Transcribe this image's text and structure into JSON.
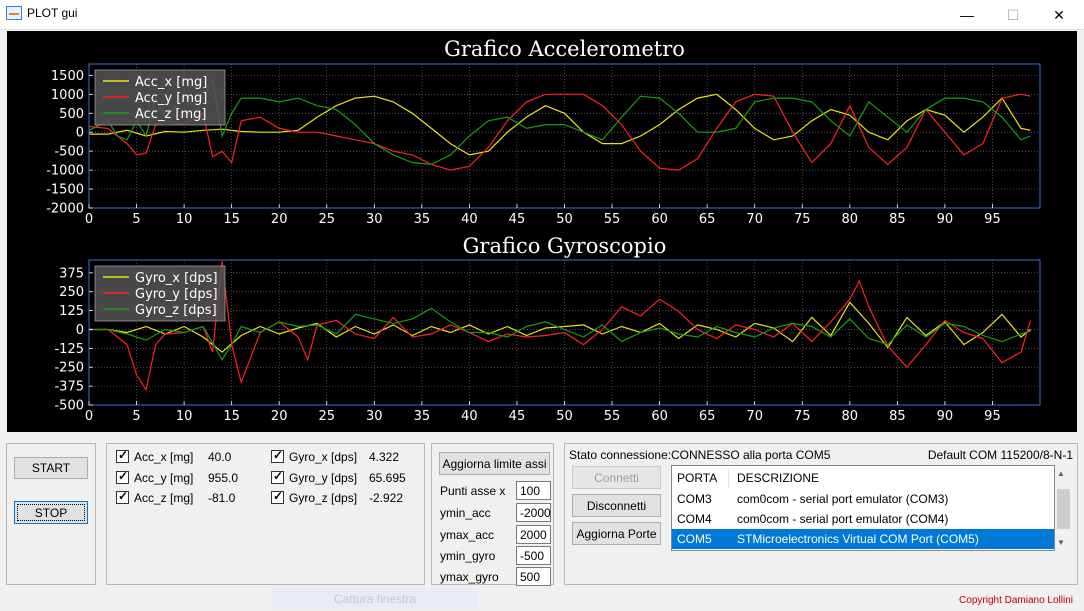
{
  "window": {
    "title": "PLOT gui",
    "minimize_glyph": "—",
    "maximize_glyph": "☐",
    "close_glyph": "✕"
  },
  "chart_data": [
    {
      "type": "line",
      "title": "Grafico Accelerometro",
      "xlim": [
        0,
        100
      ],
      "ylim": [
        -2000,
        1800
      ],
      "xticks": [
        0,
        5,
        10,
        15,
        20,
        25,
        30,
        35,
        40,
        45,
        50,
        55,
        60,
        65,
        70,
        75,
        80,
        85,
        90,
        95
      ],
      "yticks": [
        -2000,
        -1500,
        -1000,
        -500,
        0,
        500,
        1000,
        1500
      ],
      "grid": true,
      "legend_position": "top-left",
      "series": [
        {
          "name": "Acc_x [mg]",
          "color": "#e6e617",
          "x": [
            0,
            2,
            4,
            6,
            8,
            10,
            12,
            14,
            16,
            18,
            20,
            22,
            24,
            26,
            28,
            30,
            32,
            34,
            36,
            38,
            40,
            42,
            44,
            46,
            48,
            50,
            52,
            54,
            56,
            58,
            60,
            62,
            64,
            66,
            68,
            70,
            72,
            74,
            76,
            78,
            80,
            82,
            84,
            86,
            88,
            90,
            92,
            94,
            96,
            98,
            99
          ],
          "values": [
            -50,
            -50,
            50,
            -100,
            20,
            0,
            50,
            80,
            20,
            0,
            0,
            50,
            400,
            700,
            900,
            950,
            800,
            500,
            100,
            -300,
            -600,
            -500,
            0,
            400,
            700,
            500,
            0,
            -300,
            -300,
            -100,
            200,
            600,
            900,
            1000,
            600,
            100,
            -200,
            -100,
            300,
            600,
            450,
            0,
            -200,
            300,
            600,
            450,
            0,
            400,
            900,
            100,
            50
          ]
        },
        {
          "name": "Acc_y [mg]",
          "color": "#ff2020",
          "x": [
            0,
            2,
            4,
            5,
            6,
            7,
            8,
            10,
            12,
            13,
            14,
            15,
            16,
            18,
            20,
            22,
            24,
            26,
            28,
            30,
            32,
            34,
            36,
            38,
            40,
            42,
            44,
            46,
            48,
            50,
            52,
            54,
            56,
            58,
            60,
            62,
            64,
            66,
            68,
            70,
            72,
            74,
            76,
            78,
            80,
            82,
            84,
            86,
            88,
            90,
            92,
            94,
            96,
            98,
            99
          ],
          "values": [
            150,
            100,
            -300,
            -600,
            -550,
            200,
            300,
            200,
            500,
            -650,
            -500,
            -800,
            300,
            400,
            100,
            0,
            0,
            -100,
            -200,
            -300,
            -500,
            -600,
            -850,
            -1000,
            -900,
            -400,
            300,
            800,
            1000,
            1000,
            1000,
            700,
            200,
            -500,
            -950,
            -1000,
            -700,
            100,
            800,
            1000,
            950,
            0,
            -800,
            -300,
            700,
            -400,
            -850,
            -400,
            600,
            0,
            -600,
            -300,
            900,
            1000,
            950
          ]
        },
        {
          "name": "Acc_z [mg]",
          "color": "#1a9a1a",
          "x": [
            0,
            2,
            3,
            4,
            5,
            6,
            7,
            8,
            10,
            12,
            13,
            14,
            15,
            16,
            18,
            20,
            22,
            24,
            26,
            28,
            30,
            32,
            34,
            36,
            38,
            40,
            42,
            44,
            46,
            48,
            50,
            52,
            54,
            56,
            58,
            60,
            62,
            64,
            66,
            68,
            70,
            72,
            74,
            76,
            78,
            80,
            82,
            84,
            86,
            88,
            90,
            92,
            94,
            96,
            98,
            99
          ],
          "values": [
            50,
            300,
            -100,
            -200,
            300,
            -100,
            900,
            400,
            900,
            900,
            1400,
            -100,
            500,
            900,
            900,
            800,
            900,
            700,
            600,
            200,
            -300,
            -600,
            -800,
            -850,
            -600,
            -100,
            300,
            400,
            100,
            200,
            200,
            0,
            -200,
            400,
            950,
            900,
            500,
            0,
            0,
            100,
            800,
            900,
            900,
            800,
            300,
            -100,
            800,
            400,
            0,
            600,
            900,
            900,
            800,
            400,
            -200,
            -100
          ]
        }
      ]
    },
    {
      "type": "line",
      "title": "Grafico Gyroscopio",
      "xlim": [
        0,
        100
      ],
      "ylim": [
        -500,
        460
      ],
      "xticks": [
        0,
        5,
        10,
        15,
        20,
        25,
        30,
        35,
        40,
        45,
        50,
        55,
        60,
        65,
        70,
        75,
        80,
        85,
        90,
        95
      ],
      "yticks": [
        -500,
        -375,
        -250,
        -125,
        0,
        125,
        250,
        375
      ],
      "grid": true,
      "legend_position": "top-left",
      "series": [
        {
          "name": "Gyro_x [dps]",
          "color": "#e6e617",
          "x": [
            0,
            2,
            4,
            6,
            8,
            10,
            12,
            14,
            16,
            18,
            20,
            22,
            24,
            26,
            28,
            30,
            32,
            34,
            36,
            38,
            40,
            42,
            44,
            46,
            48,
            50,
            52,
            54,
            56,
            58,
            60,
            62,
            64,
            66,
            68,
            70,
            72,
            74,
            76,
            78,
            80,
            82,
            84,
            86,
            88,
            90,
            92,
            94,
            96,
            98,
            99
          ],
          "values": [
            0,
            0,
            -20,
            20,
            -30,
            20,
            -50,
            -150,
            -40,
            20,
            -30,
            10,
            40,
            -50,
            20,
            -30,
            30,
            -40,
            20,
            -20,
            30,
            -30,
            20,
            -40,
            10,
            20,
            30,
            -30,
            20,
            -20,
            40,
            -60,
            30,
            0,
            -50,
            40,
            10,
            -80,
            80,
            -40,
            180,
            40,
            -120,
            80,
            -40,
            50,
            -100,
            -20,
            100,
            -50,
            0
          ]
        },
        {
          "name": "Gyro_y [dps]",
          "color": "#ff2020",
          "x": [
            0,
            2,
            4,
            5,
            6,
            7,
            8,
            10,
            12,
            13,
            14,
            15,
            16,
            18,
            20,
            22,
            23,
            24,
            26,
            28,
            30,
            32,
            34,
            36,
            38,
            40,
            42,
            44,
            46,
            48,
            50,
            52,
            54,
            56,
            58,
            60,
            62,
            64,
            66,
            68,
            70,
            72,
            74,
            76,
            78,
            80,
            81,
            82,
            84,
            86,
            88,
            90,
            92,
            94,
            96,
            98,
            99
          ],
          "values": [
            0,
            0,
            -100,
            -300,
            -400,
            -100,
            -30,
            -20,
            20,
            -150,
            450,
            -100,
            -350,
            -20,
            50,
            -50,
            -200,
            30,
            60,
            -30,
            -60,
            80,
            -50,
            -30,
            30,
            -20,
            -80,
            -30,
            -50,
            -40,
            -20,
            -100,
            0,
            150,
            90,
            200,
            120,
            0,
            -60,
            30,
            0,
            -50,
            40,
            -80,
            50,
            200,
            320,
            150,
            -110,
            -250,
            -100,
            60,
            -20,
            -60,
            -220,
            -150,
            60
          ]
        },
        {
          "name": "Gyro_z [dps]",
          "color": "#1a9a1a",
          "x": [
            0,
            2,
            4,
            6,
            8,
            10,
            12,
            14,
            15,
            16,
            18,
            20,
            22,
            24,
            26,
            28,
            30,
            32,
            34,
            36,
            38,
            40,
            42,
            44,
            46,
            48,
            50,
            52,
            54,
            56,
            58,
            60,
            62,
            64,
            66,
            68,
            70,
            72,
            74,
            76,
            78,
            80,
            82,
            84,
            86,
            88,
            90,
            92,
            94,
            96,
            98,
            99
          ],
          "values": [
            0,
            0,
            -30,
            -70,
            0,
            -20,
            20,
            -200,
            -100,
            20,
            -20,
            50,
            20,
            30,
            -30,
            100,
            70,
            40,
            70,
            140,
            50,
            -20,
            -20,
            -50,
            20,
            50,
            0,
            -50,
            30,
            -80,
            -20,
            10,
            -30,
            -50,
            20,
            -20,
            -50,
            10,
            40,
            20,
            -50,
            70,
            -60,
            -100,
            30,
            -50,
            40,
            20,
            -40,
            -80,
            -30,
            -10
          ]
        }
      ]
    }
  ],
  "controls": {
    "start_label": "START",
    "stop_label": "STOP"
  },
  "sensors": {
    "acc": [
      {
        "label": "Acc_x [mg]",
        "value": "40.0"
      },
      {
        "label": "Acc_y [mg]",
        "value": "955.0"
      },
      {
        "label": "Acc_z [mg]",
        "value": "-81.0"
      }
    ],
    "gyro": [
      {
        "label": "Gyro_x [dps]",
        "value": "4.322"
      },
      {
        "label": "Gyro_y [dps]",
        "value": "65.695"
      },
      {
        "label": "Gyro_z [dps]",
        "value": "-2.922"
      }
    ]
  },
  "limits": {
    "update_label": "Aggiorna limite assi",
    "fields": [
      {
        "label": "Punti asse x",
        "value": "100"
      },
      {
        "label": "ymin_acc",
        "value": "-2000"
      },
      {
        "label": "ymax_acc",
        "value": "2000"
      },
      {
        "label": "ymin_gyro",
        "value": "-500"
      },
      {
        "label": "ymax_gyro",
        "value": "500"
      }
    ]
  },
  "connection": {
    "status_label": "Stato connessione:",
    "status_value": "CONNESSO alla porta COM5",
    "default_info": "Default COM 115200/8-N-1",
    "connect_label": "Connetti",
    "disconnect_label": "Disconnetti",
    "refresh_label": "Aggiorna Porte",
    "table_headers": {
      "port": "PORTA",
      "desc": "DESCRIZIONE"
    },
    "ports": [
      {
        "port": "COM3",
        "desc": "com0com - serial port emulator (COM3)",
        "selected": false
      },
      {
        "port": "COM4",
        "desc": "com0com - serial port emulator (COM4)",
        "selected": false
      },
      {
        "port": "COM5",
        "desc": "STMicroelectronics Virtual COM Port (COM5)",
        "selected": true
      }
    ]
  },
  "footer": {
    "capture_label": "Cattura finestra",
    "copyright": "Copyright Damiano Lollini"
  }
}
